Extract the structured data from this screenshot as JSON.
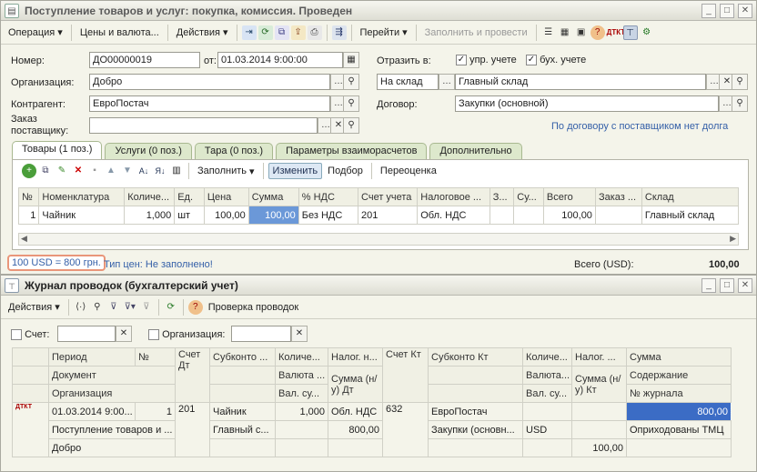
{
  "doc": {
    "title": "Поступление товаров и услуг: покупка, комиссия. Проведен",
    "toolbar": {
      "operation": "Операция",
      "prices": "Цены и валюта...",
      "actions": "Действия",
      "goto": "Перейти",
      "fill_post": "Заполнить и провести"
    },
    "number_label": "Номер:",
    "number": "ДО00000019",
    "date_label": "от:",
    "date": "01.03.2014  9:00:00",
    "reflect_label": "Отразить в:",
    "mgmt": "упр. учете",
    "acct": "бух. учете",
    "org_label": "Организация:",
    "org": "Добро",
    "warehouse_type": "На склад",
    "warehouse": "Главный склад",
    "contractor_label": "Контрагент:",
    "contractor": "ЕвроПостач",
    "contract_label": "Договор:",
    "contract": "Закупки (основной)",
    "order_label1": "Заказ",
    "order_label2": "поставщику:",
    "order": "",
    "contract_link": "По договору с поставщиком нет долга",
    "tabs": [
      "Товары (1 поз.)",
      "Услуги (0 поз.)",
      "Тара (0 поз.)",
      "Параметры взаиморасчетов",
      "Дополнительно"
    ],
    "grid_toolbar": {
      "fill": "Заполнить",
      "change": "Изменить",
      "select": "Подбор",
      "reprice": "Переоценка"
    },
    "columns": [
      "№",
      "Номенклатура",
      "Количе...",
      "Ед.",
      "Цена",
      "Сумма",
      "% НДС",
      "Счет учета",
      "Налоговое ...",
      "З...",
      "Су...",
      "Всего",
      "Заказ ...",
      "Склад"
    ],
    "rows": [
      [
        "1",
        "Чайник",
        "1,000",
        "шт",
        "100,00",
        "100,00",
        "Без НДС",
        "201",
        "Обл. НДС",
        "",
        "",
        "100,00",
        "",
        "Главный склад"
      ]
    ],
    "rate": "100 USD = 800 грн.",
    "price_type": "Тип цен: Не заполнено!",
    "total_label": "Всего (USD):",
    "total": "100,00"
  },
  "journal": {
    "title": "Журнал проводок (бухгалтерский учет)",
    "actions": "Действия",
    "check": "Проверка проводок",
    "account_label": "Счет:",
    "org_label": "Организация:",
    "h1": [
      "Период",
      "№",
      "Счет Дт",
      "Субконто ...",
      "Количе...",
      "Налог. н...",
      "Счет Кт",
      "Субконто Кт",
      "Количе...",
      "Налог. ...",
      "Сумма"
    ],
    "h2": [
      "Документ",
      "Валюта ...",
      "Сумма (н/у) Дт",
      "Валюта...",
      "Сумма (н/у) Кт",
      "Содержание"
    ],
    "h3": [
      "Организация",
      "Вал. су...",
      "Вал. су...",
      "№ журнала"
    ],
    "r1": [
      "01.03.2014 9:00...",
      "1",
      "201",
      "Чайник",
      "1,000",
      "Обл. НДС",
      "632",
      "ЕвроПостач",
      "",
      "",
      "800,00"
    ],
    "r2": [
      "Поступление товаров и ...",
      "Главный с...",
      "",
      "800,00",
      "Закупки (основн...",
      "USD",
      "",
      "Оприходованы ТМЦ"
    ],
    "r3": [
      "Добро",
      "",
      "",
      "100,00"
    ]
  }
}
